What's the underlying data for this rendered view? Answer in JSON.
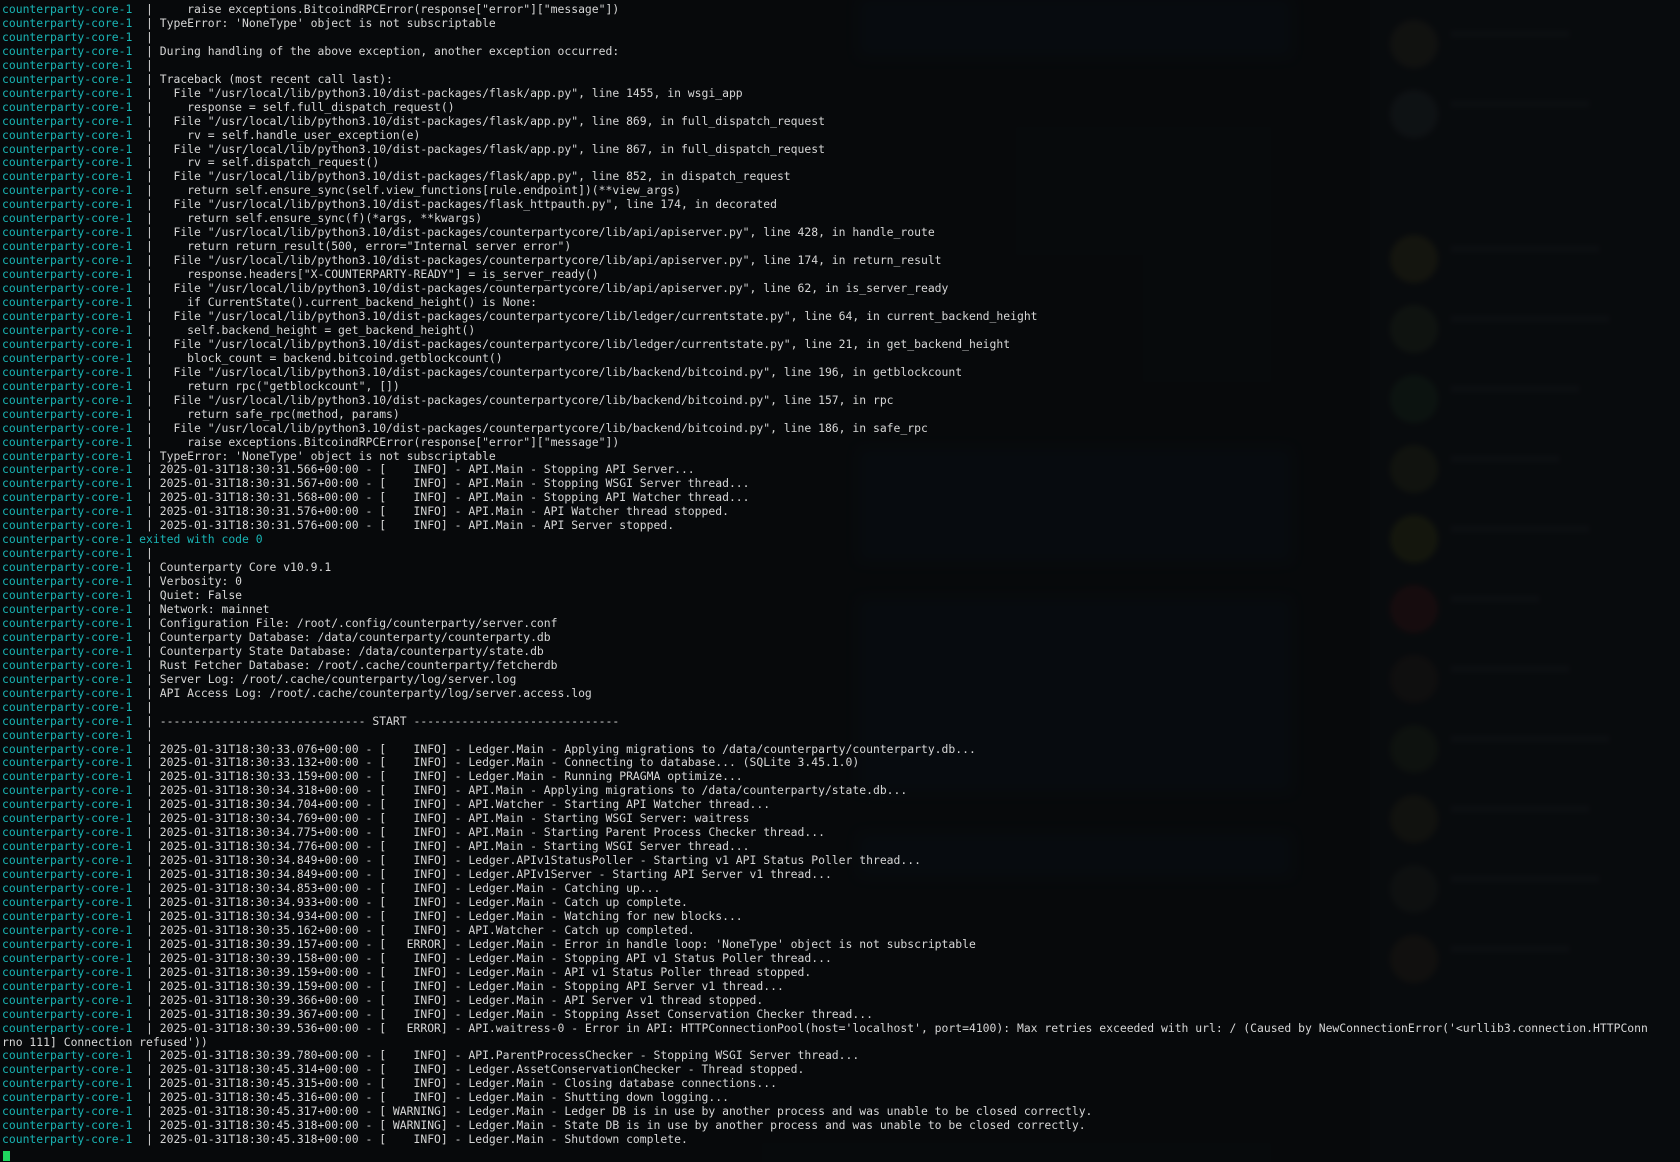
{
  "terminal": {
    "service": "counterparty-core-1",
    "lines": [
      {
        "sep": "  | ",
        "text": "    raise exceptions.BitcoindRPCError(response[\"error\"][\"message\"])"
      },
      {
        "sep": "  | ",
        "text": "TypeError: 'NoneType' object is not subscriptable"
      },
      {
        "sep": "  | ",
        "text": ""
      },
      {
        "sep": "  | ",
        "text": "During handling of the above exception, another exception occurred:"
      },
      {
        "sep": "  | ",
        "text": ""
      },
      {
        "sep": "  | ",
        "text": "Traceback (most recent call last):"
      },
      {
        "sep": "  | ",
        "text": "  File \"/usr/local/lib/python3.10/dist-packages/flask/app.py\", line 1455, in wsgi_app"
      },
      {
        "sep": "  | ",
        "text": "    response = self.full_dispatch_request()"
      },
      {
        "sep": "  | ",
        "text": "  File \"/usr/local/lib/python3.10/dist-packages/flask/app.py\", line 869, in full_dispatch_request"
      },
      {
        "sep": "  | ",
        "text": "    rv = self.handle_user_exception(e)"
      },
      {
        "sep": "  | ",
        "text": "  File \"/usr/local/lib/python3.10/dist-packages/flask/app.py\", line 867, in full_dispatch_request"
      },
      {
        "sep": "  | ",
        "text": "    rv = self.dispatch_request()"
      },
      {
        "sep": "  | ",
        "text": "  File \"/usr/local/lib/python3.10/dist-packages/flask/app.py\", line 852, in dispatch_request"
      },
      {
        "sep": "  | ",
        "text": "    return self.ensure_sync(self.view_functions[rule.endpoint])(**view_args)"
      },
      {
        "sep": "  | ",
        "text": "  File \"/usr/local/lib/python3.10/dist-packages/flask_httpauth.py\", line 174, in decorated"
      },
      {
        "sep": "  | ",
        "text": "    return self.ensure_sync(f)(*args, **kwargs)"
      },
      {
        "sep": "  | ",
        "text": "  File \"/usr/local/lib/python3.10/dist-packages/counterpartycore/lib/api/apiserver.py\", line 428, in handle_route"
      },
      {
        "sep": "  | ",
        "text": "    return return_result(500, error=\"Internal server error\")"
      },
      {
        "sep": "  | ",
        "text": "  File \"/usr/local/lib/python3.10/dist-packages/counterpartycore/lib/api/apiserver.py\", line 174, in return_result"
      },
      {
        "sep": "  | ",
        "text": "    response.headers[\"X-COUNTERPARTY-READY\"] = is_server_ready()"
      },
      {
        "sep": "  | ",
        "text": "  File \"/usr/local/lib/python3.10/dist-packages/counterpartycore/lib/api/apiserver.py\", line 62, in is_server_ready"
      },
      {
        "sep": "  | ",
        "text": "    if CurrentState().current_backend_height() is None:"
      },
      {
        "sep": "  | ",
        "text": "  File \"/usr/local/lib/python3.10/dist-packages/counterpartycore/lib/ledger/currentstate.py\", line 64, in current_backend_height"
      },
      {
        "sep": "  | ",
        "text": "    self.backend_height = get_backend_height()"
      },
      {
        "sep": "  | ",
        "text": "  File \"/usr/local/lib/python3.10/dist-packages/counterpartycore/lib/ledger/currentstate.py\", line 21, in get_backend_height"
      },
      {
        "sep": "  | ",
        "text": "    block_count = backend.bitcoind.getblockcount()"
      },
      {
        "sep": "  | ",
        "text": "  File \"/usr/local/lib/python3.10/dist-packages/counterpartycore/lib/backend/bitcoind.py\", line 196, in getblockcount"
      },
      {
        "sep": "  | ",
        "text": "    return rpc(\"getblockcount\", [])"
      },
      {
        "sep": "  | ",
        "text": "  File \"/usr/local/lib/python3.10/dist-packages/counterpartycore/lib/backend/bitcoind.py\", line 157, in rpc"
      },
      {
        "sep": "  | ",
        "text": "    return safe_rpc(method, params)"
      },
      {
        "sep": "  | ",
        "text": "  File \"/usr/local/lib/python3.10/dist-packages/counterpartycore/lib/backend/bitcoind.py\", line 186, in safe_rpc"
      },
      {
        "sep": "  | ",
        "text": "    raise exceptions.BitcoindRPCError(response[\"error\"][\"message\"])"
      },
      {
        "sep": "  | ",
        "text": "TypeError: 'NoneType' object is not subscriptable"
      },
      {
        "sep": "  | ",
        "text": "2025-01-31T18:30:31.566+00:00 - [    INFO] - API.Main - Stopping API Server..."
      },
      {
        "sep": "  | ",
        "text": "2025-01-31T18:30:31.567+00:00 - [    INFO] - API.Main - Stopping WSGI Server thread..."
      },
      {
        "sep": "  | ",
        "text": "2025-01-31T18:30:31.568+00:00 - [    INFO] - API.Main - Stopping API Watcher thread..."
      },
      {
        "sep": "  | ",
        "text": "2025-01-31T18:30:31.576+00:00 - [    INFO] - API.Main - API Watcher thread stopped."
      },
      {
        "sep": "  | ",
        "text": "2025-01-31T18:30:31.576+00:00 - [    INFO] - API.Main - API Server stopped."
      },
      {
        "sep": " ",
        "text": "exited with code 0",
        "exit": true
      },
      {
        "sep": "  | ",
        "text": ""
      },
      {
        "sep": "  | ",
        "text": "Counterparty Core v10.9.1"
      },
      {
        "sep": "  | ",
        "text": "Verbosity: 0"
      },
      {
        "sep": "  | ",
        "text": "Quiet: False"
      },
      {
        "sep": "  | ",
        "text": "Network: mainnet"
      },
      {
        "sep": "  | ",
        "text": "Configuration File: /root/.config/counterparty/server.conf"
      },
      {
        "sep": "  | ",
        "text": "Counterparty Database: /data/counterparty/counterparty.db"
      },
      {
        "sep": "  | ",
        "text": "Counterparty State Database: /data/counterparty/state.db"
      },
      {
        "sep": "  | ",
        "text": "Rust Fetcher Database: /root/.cache/counterparty/fetcherdb"
      },
      {
        "sep": "  | ",
        "text": "Server Log: /root/.cache/counterparty/log/server.log"
      },
      {
        "sep": "  | ",
        "text": "API Access Log: /root/.cache/counterparty/log/server.access.log"
      },
      {
        "sep": "  | ",
        "text": ""
      },
      {
        "sep": "  | ",
        "text": "------------------------------ START ------------------------------"
      },
      {
        "sep": "  | ",
        "text": ""
      },
      {
        "sep": "  | ",
        "text": "2025-01-31T18:30:33.076+00:00 - [    INFO] - Ledger.Main - Applying migrations to /data/counterparty/counterparty.db..."
      },
      {
        "sep": "  | ",
        "text": "2025-01-31T18:30:33.132+00:00 - [    INFO] - Ledger.Main - Connecting to database... (SQLite 3.45.1.0)"
      },
      {
        "sep": "  | ",
        "text": "2025-01-31T18:30:33.159+00:00 - [    INFO] - Ledger.Main - Running PRAGMA optimize..."
      },
      {
        "sep": "  | ",
        "text": "2025-01-31T18:30:34.318+00:00 - [    INFO] - API.Main - Applying migrations to /data/counterparty/state.db..."
      },
      {
        "sep": "  | ",
        "text": "2025-01-31T18:30:34.704+00:00 - [    INFO] - API.Watcher - Starting API Watcher thread..."
      },
      {
        "sep": "  | ",
        "text": "2025-01-31T18:30:34.769+00:00 - [    INFO] - API.Main - Starting WSGI Server: waitress"
      },
      {
        "sep": "  | ",
        "text": "2025-01-31T18:30:34.775+00:00 - [    INFO] - API.Main - Starting Parent Process Checker thread..."
      },
      {
        "sep": "  | ",
        "text": "2025-01-31T18:30:34.776+00:00 - [    INFO] - API.Main - Starting WSGI Server thread..."
      },
      {
        "sep": "  | ",
        "text": "2025-01-31T18:30:34.849+00:00 - [    INFO] - Ledger.APIv1StatusPoller - Starting v1 API Status Poller thread..."
      },
      {
        "sep": "  | ",
        "text": "2025-01-31T18:30:34.849+00:00 - [    INFO] - Ledger.APIv1Server - Starting API Server v1 thread..."
      },
      {
        "sep": "  | ",
        "text": "2025-01-31T18:30:34.853+00:00 - [    INFO] - Ledger.Main - Catching up..."
      },
      {
        "sep": "  | ",
        "text": "2025-01-31T18:30:34.933+00:00 - [    INFO] - Ledger.Main - Catch up complete."
      },
      {
        "sep": "  | ",
        "text": "2025-01-31T18:30:34.934+00:00 - [    INFO] - Ledger.Main - Watching for new blocks..."
      },
      {
        "sep": "  | ",
        "text": "2025-01-31T18:30:35.162+00:00 - [    INFO] - API.Watcher - Catch up completed."
      },
      {
        "sep": "  | ",
        "text": "2025-01-31T18:30:39.157+00:00 - [   ERROR] - Ledger.Main - Error in handle loop: 'NoneType' object is not subscriptable"
      },
      {
        "sep": "  | ",
        "text": "2025-01-31T18:30:39.158+00:00 - [    INFO] - Ledger.Main - Stopping API v1 Status Poller thread..."
      },
      {
        "sep": "  | ",
        "text": "2025-01-31T18:30:39.159+00:00 - [    INFO] - Ledger.Main - API v1 Status Poller thread stopped."
      },
      {
        "sep": "  | ",
        "text": "2025-01-31T18:30:39.159+00:00 - [    INFO] - Ledger.Main - Stopping API Server v1 thread..."
      },
      {
        "sep": "  | ",
        "text": "2025-01-31T18:30:39.366+00:00 - [    INFO] - Ledger.Main - API Server v1 thread stopped."
      },
      {
        "sep": "  | ",
        "text": "2025-01-31T18:30:39.367+00:00 - [    INFO] - Ledger.Main - Stopping Asset Conservation Checker thread..."
      },
      {
        "sep": "  | ",
        "text": "2025-01-31T18:30:39.536+00:00 - [   ERROR] - API.waitress-0 - Error in API: HTTPConnectionPool(host='localhost', port=4100): Max retries exceeded with url: / (Caused by NewConnectionError('<urllib3.connection.HTTPConn"
      },
      {
        "sep": "",
        "text": "rno 111] Connection refused'))",
        "wrap": true
      },
      {
        "sep": "  | ",
        "text": "2025-01-31T18:30:39.780+00:00 - [    INFO] - API.ParentProcessChecker - Stopping WSGI Server thread..."
      },
      {
        "sep": "  | ",
        "text": "2025-01-31T18:30:45.314+00:00 - [    INFO] - Ledger.AssetConservationChecker - Thread stopped."
      },
      {
        "sep": "  | ",
        "text": "2025-01-31T18:30:45.315+00:00 - [    INFO] - Ledger.Main - Closing database connections..."
      },
      {
        "sep": "  | ",
        "text": "2025-01-31T18:30:45.316+00:00 - [    INFO] - Ledger.Main - Shutting down logging..."
      },
      {
        "sep": "  | ",
        "text": "2025-01-31T18:30:45.317+00:00 - [ WARNING] - Ledger.Main - Ledger DB is in use by another process and was unable to be closed correctly."
      },
      {
        "sep": "  | ",
        "text": "2025-01-31T18:30:45.318+00:00 - [ WARNING] - Ledger.Main - State DB is in use by another process and was unable to be closed correctly."
      },
      {
        "sep": "  | ",
        "text": "2025-01-31T18:30:45.318+00:00 - [    INFO] - Ledger.Main - Shutdown complete."
      }
    ]
  },
  "colors": {
    "service_prefix": "#19b5b5",
    "text": "#d7d7d7",
    "cursor": "#1fd65f"
  }
}
